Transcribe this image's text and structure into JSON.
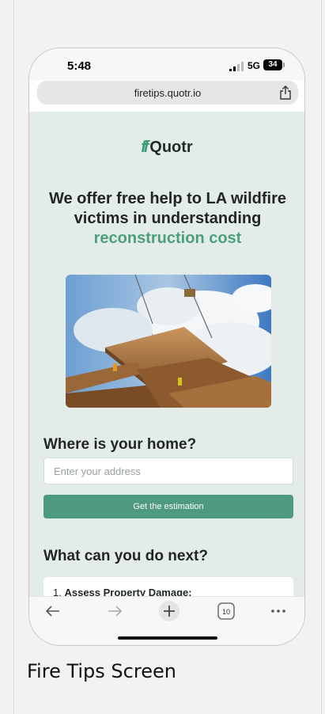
{
  "status_bar": {
    "time": "5:48",
    "network": "5G",
    "battery": "34"
  },
  "browser": {
    "url": "firetips.quotr.io",
    "tab_count": "10"
  },
  "logo": {
    "mark": "ff",
    "name": "Quotr"
  },
  "hero": {
    "headline_line1": "We offer free help to LA wildfire",
    "headline_line2": "victims in understanding",
    "headline_accent": "reconstruction cost"
  },
  "address_section": {
    "title": "Where is your home?",
    "placeholder": "Enter your address",
    "value": "",
    "button_label": "Get the estimation"
  },
  "next_section": {
    "title": "What can you do next?",
    "first_item_number": "1.",
    "first_item_title": "Assess Property Damage:"
  },
  "caption": "Fire Tips Screen",
  "colors": {
    "accent": "#4e9a7e",
    "content_background": "#e4ece9"
  }
}
